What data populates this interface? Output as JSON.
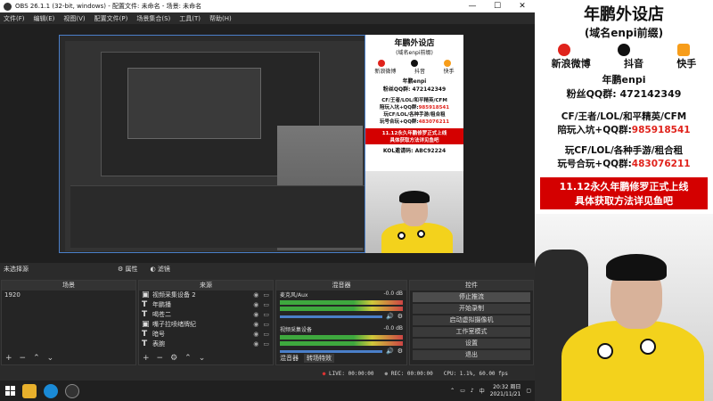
{
  "window": {
    "title": "OBS 26.1.1 (32-bit, windows) - 配置文件: 未命名 - 场景: 未命名",
    "minimize": "—",
    "maximize": "☐",
    "close": "✕"
  },
  "menu": [
    "文件(F)",
    "编辑(E)",
    "视图(V)",
    "配置文件(P)",
    "场景集合(S)",
    "工具(T)",
    "帮助(H)"
  ],
  "overlay": {
    "shop_name": "年鹏外设店",
    "shop_sub": "(域名enpi前缀)",
    "social": [
      {
        "label": "新浪微博",
        "icon": "weibo-icon"
      },
      {
        "label": "抖音",
        "icon": "douyin-icon"
      },
      {
        "label": "快手",
        "icon": "kuaishou-icon"
      }
    ],
    "host": "年鹏enpi",
    "fans_group": "粉丝QQ群: 472142349",
    "cf_line": "CF/王者/LOL/和平精英/CFM",
    "cf_line2_a": "陪玩入坑+QQ群:",
    "cf_line2_b": "985918541",
    "play_line": "玩CF/LOL/各种手游/租合租",
    "play_line2_a": "玩号合玩+QQ群:",
    "play_line2_b": "483076211",
    "event_line1": "11.12永久年鹏修罗正式上线",
    "event_line2": "具体获取方法详见鱼吧",
    "kol": "KOL邀请码: ABC92224"
  },
  "docks": {
    "no_source": "未选择源",
    "properties": "属性",
    "filters": "滤镜",
    "scenes": {
      "header": "场景",
      "items": [
        "1920"
      ]
    },
    "sources": {
      "header": "来源",
      "items": [
        {
          "icon": "camera-icon",
          "glyph": "▣",
          "label": "视频采集设备 2"
        },
        {
          "icon": "text-icon",
          "glyph": "T",
          "label": "年鹏播"
        },
        {
          "icon": "text-icon",
          "glyph": "T",
          "label": "喝苍二"
        },
        {
          "icon": "window-capture-icon",
          "glyph": "▣",
          "label": "嘴子拉喷绪牌纪"
        },
        {
          "icon": "text-icon",
          "glyph": "T",
          "label": "暗号"
        },
        {
          "icon": "text-icon",
          "glyph": "T",
          "label": "表腕"
        }
      ]
    },
    "mixer": {
      "header": "混音器",
      "channels": [
        {
          "name": "麦克风/Aux",
          "db": "-0.0 dB"
        },
        {
          "name": "视频采集设备",
          "db": "-0.0 dB"
        }
      ],
      "tab_mixer": "混音器",
      "tab_transition": "转场特效"
    },
    "controls": {
      "header": "控件",
      "buttons": [
        "停止推流",
        "开始录制",
        "启动虚拟摄像机",
        "工作室模式",
        "设置",
        "退出"
      ]
    }
  },
  "status": {
    "live": "LIVE: 00:00:00",
    "rec": "REC: 00:00:00",
    "cpu": "CPU: 1.1%, 60.00 fps"
  },
  "taskbar": {
    "clock_time": "20:32 周日",
    "clock_date": "2021/11/21",
    "apps": [
      {
        "icon": "owl-app-icon",
        "color": "#e8b02c"
      },
      {
        "icon": "browser-icon",
        "color": "#1a8ad6"
      },
      {
        "icon": "obs-icon",
        "color": "#333333"
      }
    ]
  },
  "colors": {
    "accent_red": "#e0231c",
    "selection_blue": "#4a7fc9",
    "shirt_yellow": "#f3d21c"
  }
}
